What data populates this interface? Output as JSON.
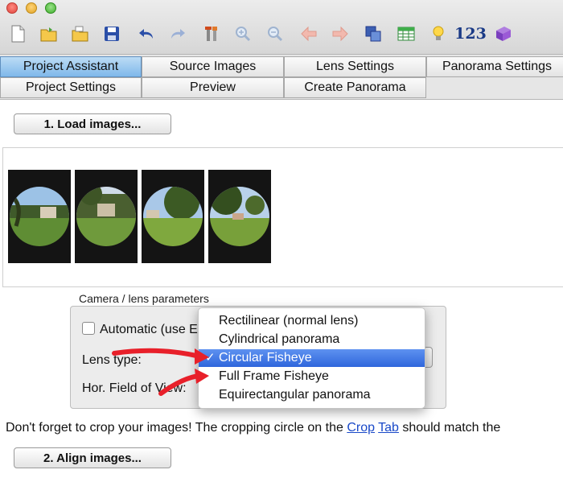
{
  "toolbar": {
    "icons": [
      "new-file-icon",
      "open-folder-icon",
      "open-recent-icon",
      "save-icon",
      "undo-icon",
      "redo-icon",
      "tools-icon",
      "zoom-in-icon",
      "zoom-out-icon",
      "previous-icon",
      "next-icon",
      "copy-icon",
      "table-icon",
      "light-bulb-icon",
      "numbers-icon",
      "help-book-icon"
    ],
    "number_label": "123"
  },
  "tabs": {
    "row1": [
      "Project Assistant",
      "Source Images",
      "Lens Settings",
      "Panorama Settings"
    ],
    "row2": [
      "Project Settings",
      "Preview",
      "Create Panorama"
    ],
    "active": "Project Assistant"
  },
  "buttons": {
    "load": "1. Load images...",
    "align": "2. Align images..."
  },
  "camera": {
    "group_label": "Camera / lens parameters",
    "automatic_label": "Automatic (use EXIF data when available)",
    "lens_type_label": "Lens type:",
    "hfov_label": "Hor. Field of View:"
  },
  "lens_menu": {
    "options": [
      "Rectilinear (normal lens)",
      "Cylindrical panorama",
      "Circular Fisheye",
      "Full Frame Fisheye",
      "Equirectangular panorama"
    ],
    "selected": "Circular Fisheye",
    "check_mark": "✓"
  },
  "footer": {
    "text_before": "Don't forget to crop your images! The cropping circle on the ",
    "link_crop": "Crop",
    "link_tab": "Tab",
    "text_after": " should match the"
  },
  "colors": {
    "accent": "#2f66dc",
    "active_tab": "#7fb8ea",
    "arrow_red": "#e8202a"
  }
}
